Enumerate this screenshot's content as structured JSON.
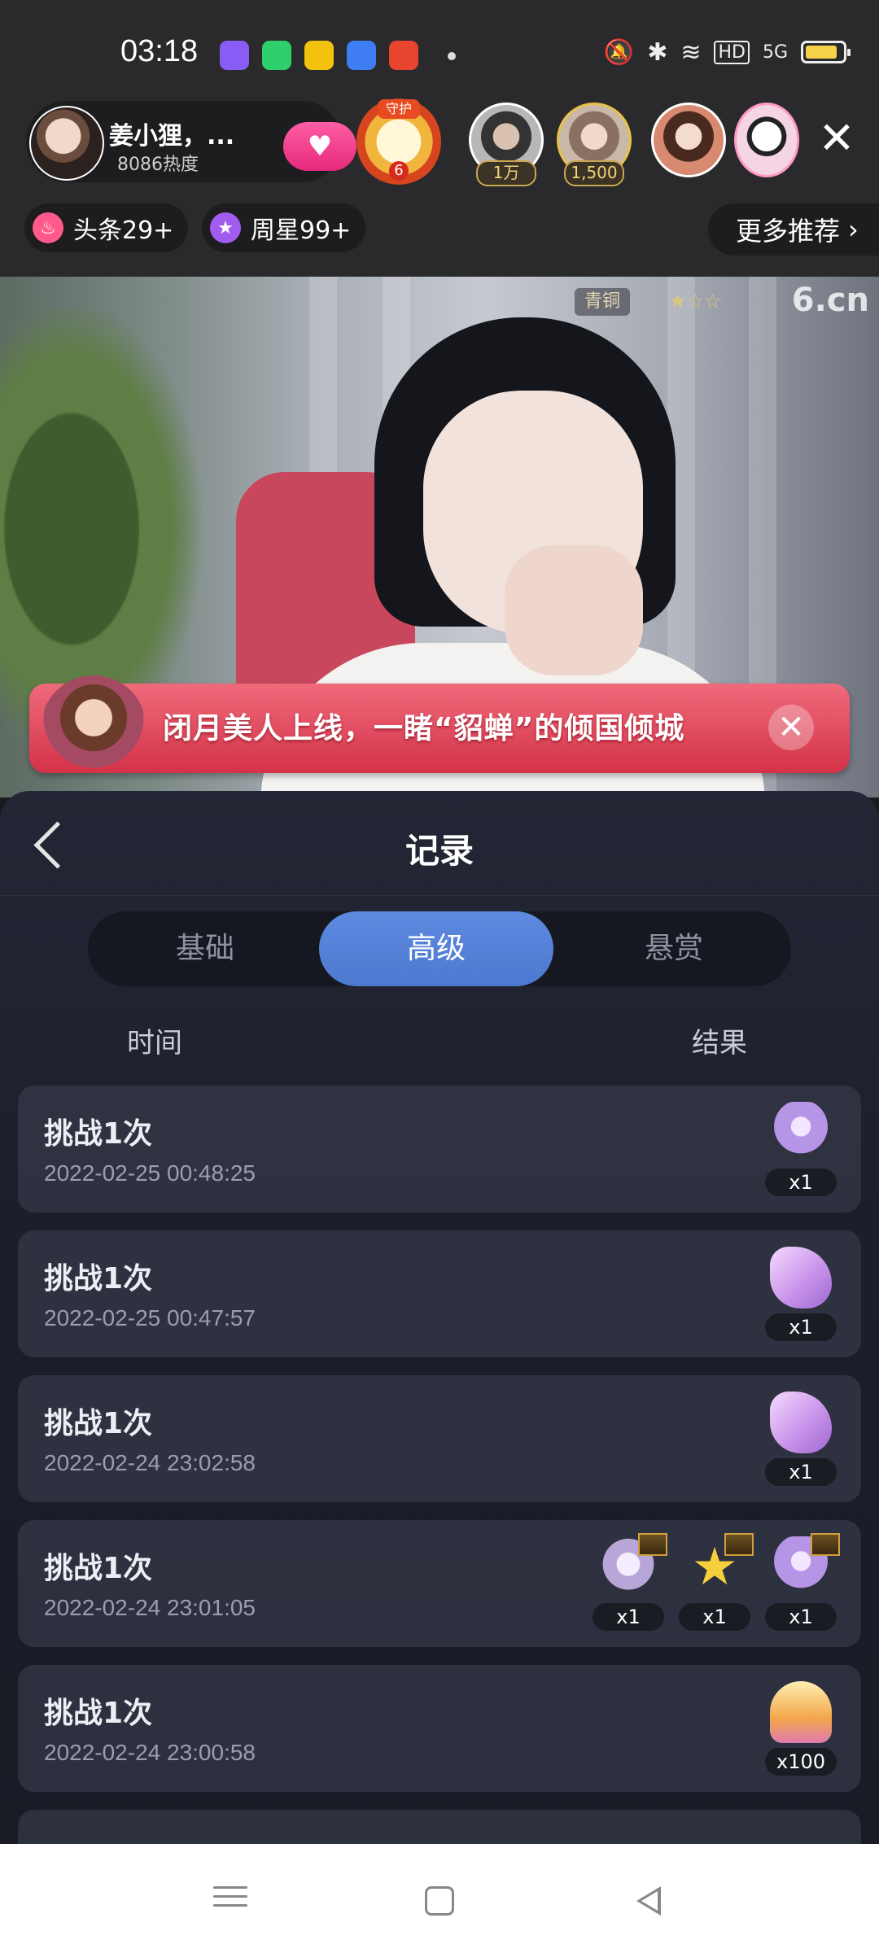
{
  "status_bar": {
    "time": "03:18",
    "network": "5G",
    "hd": "HD"
  },
  "anchor": {
    "name": "姜小狸，...",
    "heat": "8086热度"
  },
  "guard_badge": {
    "top_label": "守护",
    "count": "6"
  },
  "viewers": [
    {
      "badge": "1万"
    },
    {
      "badge": "1,500"
    },
    {
      "badge": ""
    },
    {
      "badge": ""
    }
  ],
  "ranks": {
    "headline": "头条29+",
    "weekly_star": "周星99+",
    "more": "更多推荐"
  },
  "video_overlay": {
    "rank_badge": "青铜",
    "stars": "★☆☆",
    "logo": "6.cn"
  },
  "promo": {
    "text": "闭月美人上线，一睹“貂蝉”的倾国倾城"
  },
  "sheet": {
    "title": "记录",
    "tabs": [
      {
        "label": "基础",
        "active": false
      },
      {
        "label": "高级",
        "active": true
      },
      {
        "label": "悬赏",
        "active": false
      }
    ],
    "col_time": "时间",
    "col_result": "结果",
    "records": [
      {
        "title": "挑战1次",
        "time": "2022-02-25 00:48:25",
        "prizes": [
          {
            "icon": "carriage-icon",
            "qty": "x1"
          }
        ]
      },
      {
        "title": "挑战1次",
        "time": "2022-02-25 00:47:57",
        "prizes": [
          {
            "icon": "glove-icon",
            "qty": "x1"
          }
        ]
      },
      {
        "title": "挑战1次",
        "time": "2022-02-24 23:02:58",
        "prizes": [
          {
            "icon": "glove-icon",
            "qty": "x1"
          }
        ]
      },
      {
        "title": "挑战1次",
        "time": "2022-02-24 23:01:05",
        "prizes": [
          {
            "icon": "pegasus-icon",
            "qty": "x1"
          },
          {
            "icon": "star-trophy-icon",
            "qty": "x1"
          },
          {
            "icon": "carriage-icon",
            "qty": "x1"
          }
        ]
      },
      {
        "title": "挑战1次",
        "time": "2022-02-24 23:00:58",
        "prizes": [
          {
            "icon": "shell-icon",
            "qty": "x100"
          }
        ]
      }
    ]
  },
  "colors": {
    "accent": "#5d8be0",
    "promo": "#d43248",
    "heart": "#ff5fa5"
  }
}
